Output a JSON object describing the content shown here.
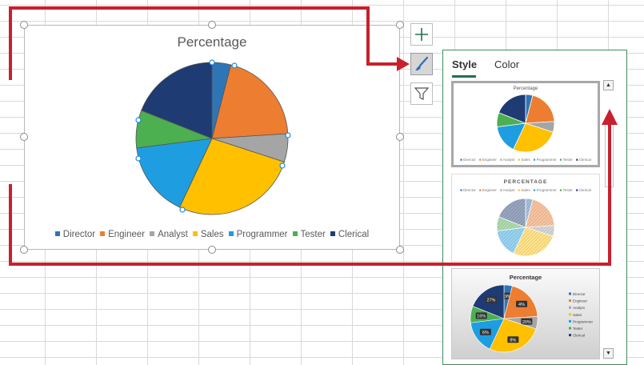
{
  "chart_data": {
    "type": "pie",
    "title": "Percentage",
    "categories": [
      "Director",
      "Engineer",
      "Analyst",
      "Sales",
      "Programmer",
      "Tester",
      "Clerical"
    ],
    "values": [
      4,
      20,
      6,
      27,
      16,
      8,
      19
    ],
    "colors": [
      "#2e75b6",
      "#ed7d31",
      "#a5a5a5",
      "#ffc000",
      "#1e9ee0",
      "#4caf50",
      "#1f3b73"
    ],
    "legend": "bottom"
  },
  "format_panel": {
    "tabs": [
      "Style",
      "Color"
    ],
    "active_tab": "Style",
    "styles": [
      {
        "title": "Percentage"
      },
      {
        "title": "PERCENTAGE"
      },
      {
        "title": "Percentage",
        "data_labels": [
          "19%",
          "4%",
          "20%",
          "8%",
          "6%",
          "16%",
          "27%"
        ]
      }
    ],
    "scroll_up_icon": "triangle-up-icon",
    "scroll_down_icon": "triangle-down-icon"
  },
  "side_buttons": [
    "plus-icon",
    "paintbrush-icon",
    "funnel-icon"
  ],
  "annotation_color": "#c8202e"
}
